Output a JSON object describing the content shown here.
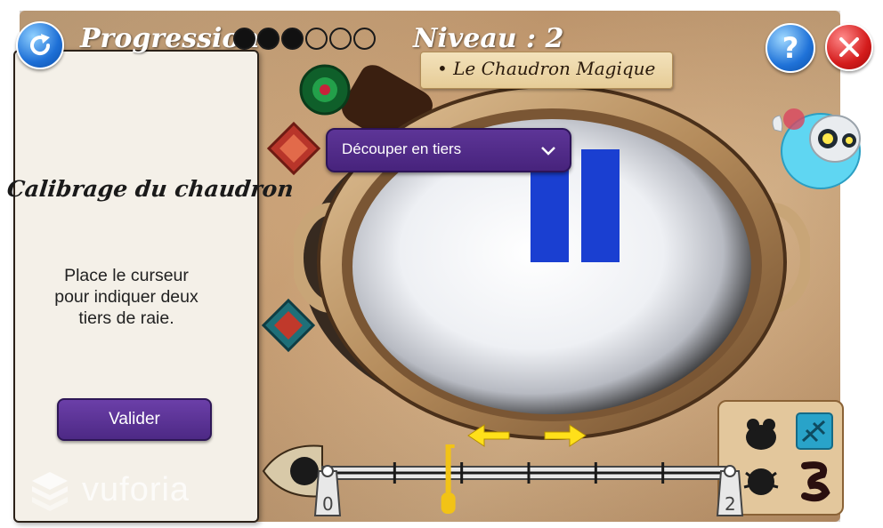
{
  "header": {
    "progress_label": "Progression:",
    "progress_dots": [
      true,
      true,
      true,
      false,
      false,
      false
    ],
    "level_label": "Niveau : 2",
    "level_subtitle": "• Le Chaudron Magique",
    "refresh_icon": "refresh-icon",
    "help_label": "?",
    "close_icon": "close-icon"
  },
  "panel": {
    "title": "Calibrage du chaudron",
    "instruction": "Place le curseur pour indiquer deux tiers de raie.",
    "validate_label": "Valider"
  },
  "dropdown": {
    "selected": "Découper en tiers"
  },
  "slider": {
    "min_label": "0",
    "max_label": "2",
    "value": 0.6,
    "tick_count": 6
  },
  "branding": {
    "watermark": "vuforia"
  },
  "colors": {
    "accent_purple": "#5d3597",
    "bar_blue": "#1a3fd1",
    "handle_yellow": "#f2c316",
    "arrow_yellow": "#ffe01a"
  }
}
